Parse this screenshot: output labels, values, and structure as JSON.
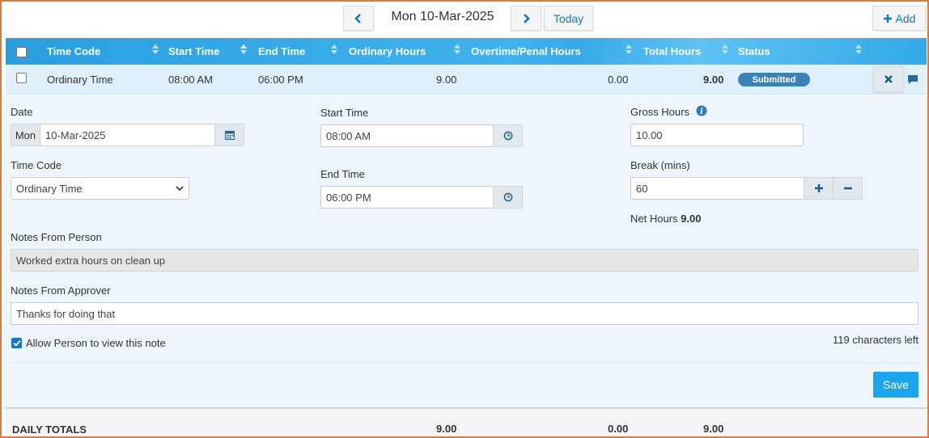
{
  "nav": {
    "current_date": "Mon 10-Mar-2025",
    "today_label": "Today",
    "add_label": "Add"
  },
  "grid": {
    "headers": {
      "time_code": "Time Code",
      "start_time": "Start Time",
      "end_time": "End Time",
      "ordinary_hours": "Ordinary Hours",
      "overtime_penal_hours": "Overtime/Penal Hours",
      "total_hours": "Total Hours",
      "status": "Status"
    },
    "row": {
      "time_code": "Ordinary Time",
      "start_time": "08:00 AM",
      "end_time": "06:00 PM",
      "ordinary_hours": "9.00",
      "overtime_hours": "0.00",
      "total_hours": "9.00",
      "status": "Submitted"
    }
  },
  "detail": {
    "date_label": "Date",
    "date_day": "Mon",
    "date_value": "10-Mar-2025",
    "start_time_label": "Start Time",
    "start_time_value": "08:00 AM",
    "gross_hours_label": "Gross Hours",
    "gross_hours_value": "10.00",
    "time_code_label": "Time Code",
    "time_code_value": "Ordinary Time",
    "end_time_label": "End Time",
    "end_time_value": "06:00 PM",
    "break_label": "Break (mins)",
    "break_value": "60",
    "net_hours_label": "Net Hours",
    "net_hours_value": "9.00",
    "notes_person_label": "Notes From Person",
    "notes_person_value": "Worked extra hours on clean up",
    "notes_approver_label": "Notes From Approver",
    "notes_approver_value": "Thanks for doing that",
    "allow_view_label": "Allow Person to view this note",
    "allow_view_checked": true,
    "chars_left": "119 characters left",
    "save_label": "Save"
  },
  "totals": {
    "label": "DAILY TOTALS",
    "ordinary_hours": "9.00",
    "overtime_hours": "0.00",
    "total_hours": "9.00"
  },
  "colors": {
    "header_blue": "#2a9fe0",
    "badge_blue": "#3b83b6",
    "save_blue": "#1aa6ea",
    "frame_orange": "#e07a3a"
  }
}
